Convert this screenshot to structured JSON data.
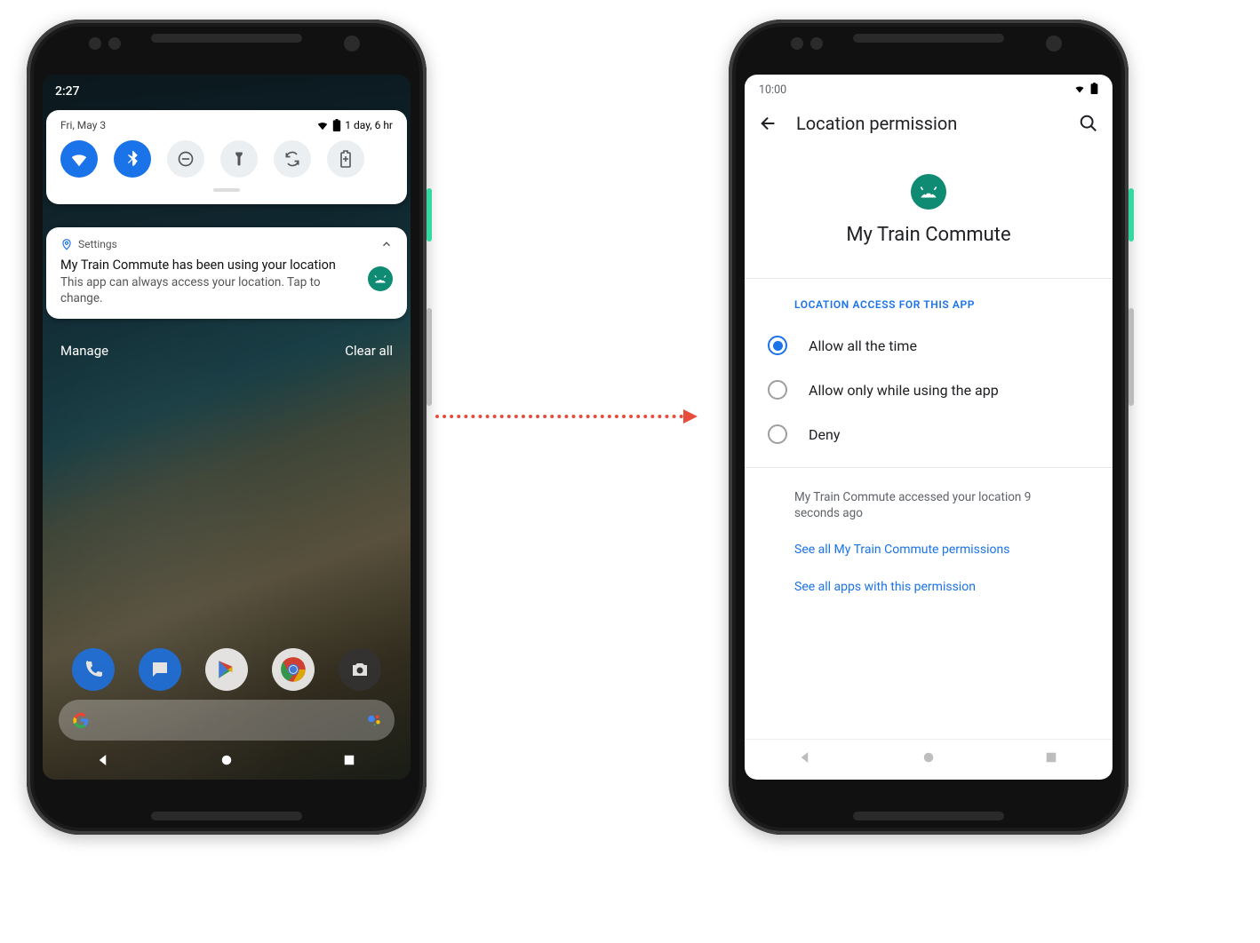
{
  "left": {
    "status_time": "2:27",
    "qs_date": "Fri, May 3",
    "battery_text": "1 day, 6 hr",
    "toggles": {
      "wifi": "wifi",
      "bluetooth": "bluetooth",
      "dnd": "do-not-disturb",
      "torch": "flashlight",
      "rotate": "auto-rotate",
      "battery": "battery-saver"
    },
    "notification": {
      "source": "Settings",
      "title": "My Train Commute has been using your location",
      "body": "This app can always access your location. Tap to change."
    },
    "actions": {
      "manage": "Manage",
      "clear": "Clear all"
    },
    "dock_apps": [
      "phone",
      "messages",
      "play-store",
      "chrome",
      "camera"
    ]
  },
  "right": {
    "status_time": "10:00",
    "page_title": "Location permission",
    "app_name": "My Train Commute",
    "section_header": "LOCATION ACCESS FOR THIS APP",
    "options": [
      {
        "label": "Allow all the time",
        "selected": true
      },
      {
        "label": "Allow only while using the app",
        "selected": false
      },
      {
        "label": "Deny",
        "selected": false
      }
    ],
    "info_text": "My Train Commute accessed your location 9 seconds ago",
    "links": {
      "app_permissions": "See all My Train Commute permissions",
      "all_apps": "See all apps with this permission"
    }
  }
}
